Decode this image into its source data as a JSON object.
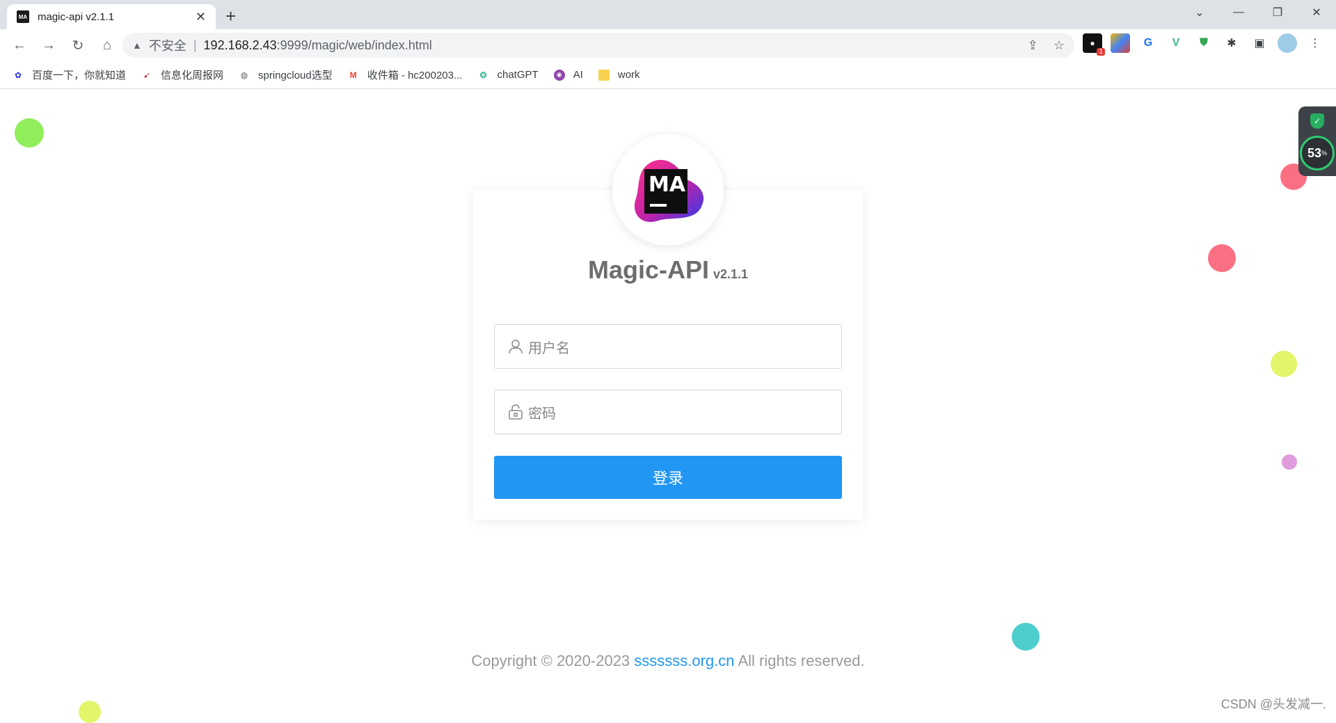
{
  "tab": {
    "title": "magic-api v2.1.1",
    "favicon_text": "MA",
    "close": "✕"
  },
  "new_tab": "+",
  "window": {
    "dropdown": "⌄",
    "minimize": "—",
    "restore": "❐",
    "close": "✕"
  },
  "toolbar": {
    "back": "←",
    "forward": "→",
    "reload": "↻",
    "home": "⌂",
    "security_label": "不安全",
    "url_host": "192.168.2.43",
    "url_rest": ":9999/magic/web/index.html"
  },
  "bookmarks": [
    {
      "label": "百度一下，你就知道",
      "icon": "paw-icon",
      "color": "#2932e1"
    },
    {
      "label": "信息化周报网",
      "icon": "shoe-icon",
      "color": "#d32f2f"
    },
    {
      "label": "springcloud选型",
      "icon": "globe-icon",
      "color": "#5f6368"
    },
    {
      "label": "收件箱 - hc200203...",
      "icon": "gmail-icon",
      "color": "#ea4335"
    },
    {
      "label": "chatGPT",
      "icon": "openai-icon",
      "color": "#10a37f"
    },
    {
      "label": "AI",
      "icon": "chat-bubble-icon",
      "color": "#8e44ad"
    },
    {
      "label": "work",
      "icon": "folder-icon",
      "color": "#f7d24f"
    }
  ],
  "extensions": {
    "badge": "1"
  },
  "login": {
    "logo_text": "MA",
    "app_name": "Magic-API",
    "version": "v2.1.1",
    "username_placeholder": "用户名",
    "password_placeholder": "密码",
    "submit_label": "登录"
  },
  "footer": {
    "prefix": "Copyright © 2020-2023 ",
    "link": "sssssss.org.cn",
    "suffix": " All rights reserved."
  },
  "side_widget": {
    "percent": "53",
    "unit": "%"
  },
  "watermark": "CSDN @头发减一."
}
